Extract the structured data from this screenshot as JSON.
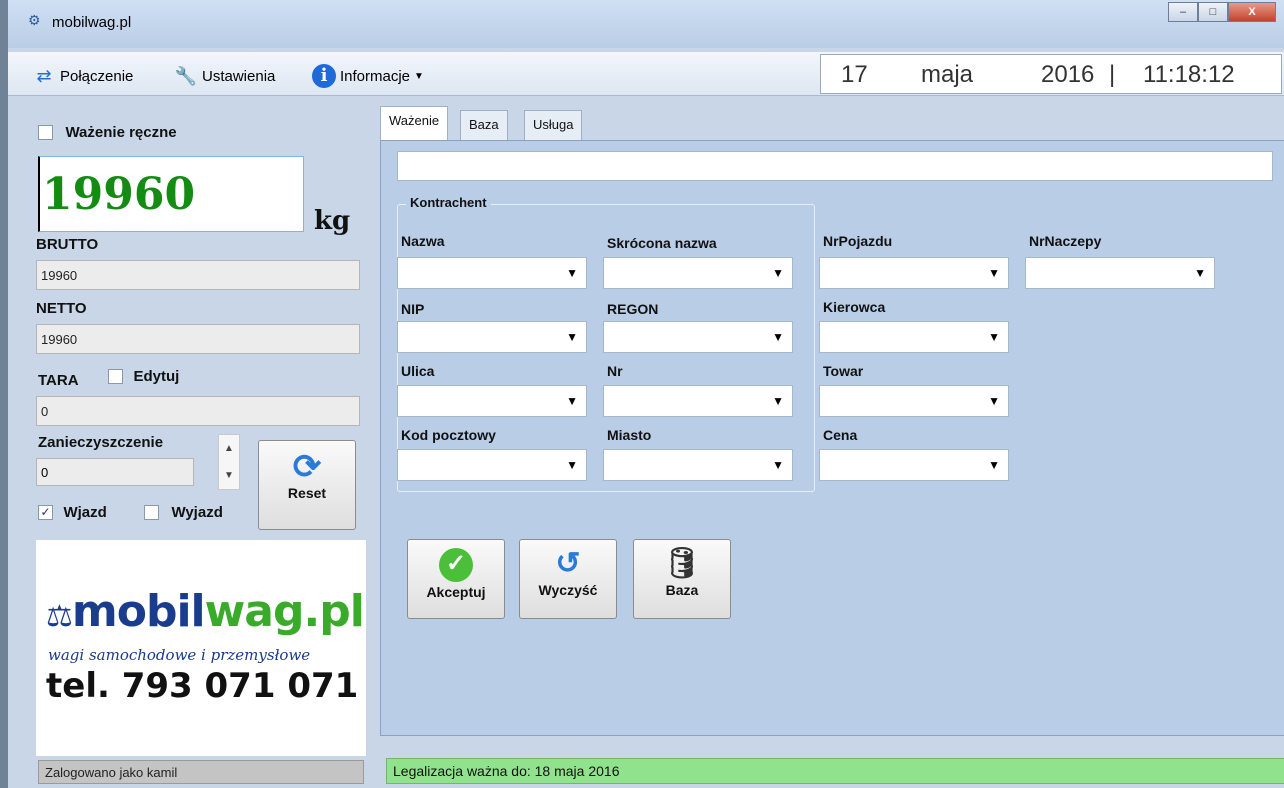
{
  "window": {
    "title": "mobilwag.pl",
    "buttons": {
      "minimize": "–",
      "maximize": "□",
      "close": "X"
    }
  },
  "toolbar": {
    "items": [
      {
        "label": "Połączenie",
        "icon": "arrows-exchange-icon"
      },
      {
        "label": "Ustawienia",
        "icon": "wrench-icon"
      },
      {
        "label": "Informacje",
        "icon": "info-icon",
        "dropdown": true
      }
    ]
  },
  "clock": {
    "day": "17",
    "month": "maja",
    "year": "2016",
    "separator": "|",
    "time": "11:18:12"
  },
  "left": {
    "manual_weighing_label": "Ważenie ręczne",
    "weight_value": "19960",
    "weight_unit": "kg",
    "brutto_label": "BRUTTO",
    "brutto_value": "19960",
    "netto_label": "NETTO",
    "netto_value": "19960",
    "tara_label": "TARA",
    "edit_label": "Edytuj",
    "tara_value": "0",
    "contamination_label": "Zanieczyszczenie",
    "contamination_value": "0",
    "entry_label": "Wjazd",
    "exit_label": "Wyjazd",
    "reset_label": "Reset"
  },
  "logo": {
    "brand_dark": "mobil",
    "brand_accent": "wag.pl",
    "tagline": "wagi samochodowe i przemysłowe",
    "phone": "tel. 793 071 071"
  },
  "tabs": [
    "Ważenie",
    "Baza",
    "Usługa"
  ],
  "form": {
    "group_title": "Kontrachent",
    "fields": {
      "nazwa": "Nazwa",
      "skrocona": "Skrócona nazwa",
      "nip": "NIP",
      "regon": "REGON",
      "ulica": "Ulica",
      "nr": "Nr",
      "kod": "Kod pocztowy",
      "miasto": "Miasto",
      "nrpojazdu": "NrPojazdu",
      "nrnaczepy": "NrNaczepy",
      "kierowca": "Kierowca",
      "towar": "Towar",
      "cena": "Cena"
    },
    "buttons": {
      "accept": "Akceptuj",
      "clear": "Wyczyść",
      "base": "Baza"
    }
  },
  "status": {
    "user": "Zalogowano jako kamil",
    "legalization": "Legalizacja ważna do: 18 maja 2016"
  },
  "colors": {
    "weight_text": "#148c14",
    "status_ok": "#90e28c",
    "logo_blue": "#1a3c8c",
    "logo_green": "#3aaa2a"
  }
}
